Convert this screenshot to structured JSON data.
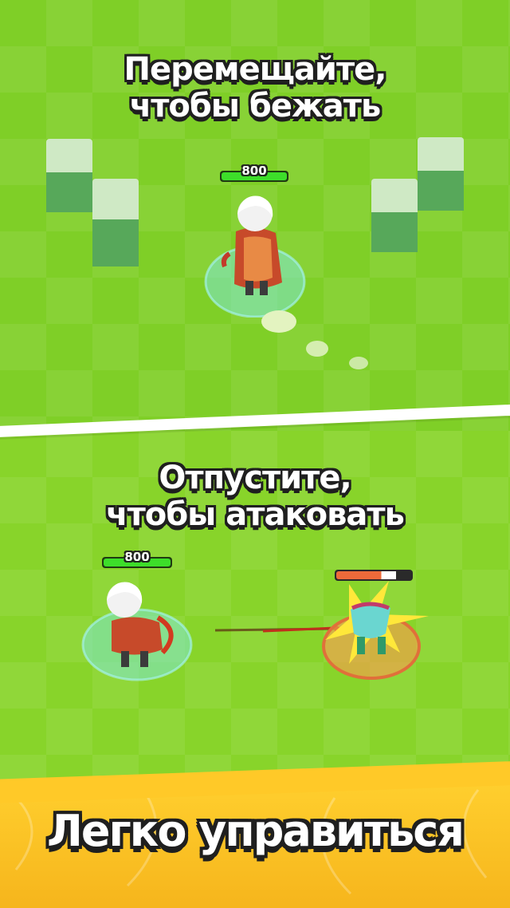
{
  "top_panel": {
    "caption_line1": "Перемещайте,",
    "caption_line2": "чтобы бежать",
    "hero_hp": "800"
  },
  "bottom_panel": {
    "caption_line1": "Отпустите,",
    "caption_line2": "чтобы атаковать",
    "hero_hp": "800",
    "enemy_hp_fraction": 0.8
  },
  "footer": {
    "title": "Легко управиться"
  },
  "colors": {
    "grass": "#7fcf27",
    "block_top": "#cfe9c5",
    "block_side": "#57a85a",
    "footer": "#ffc928",
    "hp_green": "#3dde2a",
    "enemy_hp": "#ee6a3a"
  }
}
